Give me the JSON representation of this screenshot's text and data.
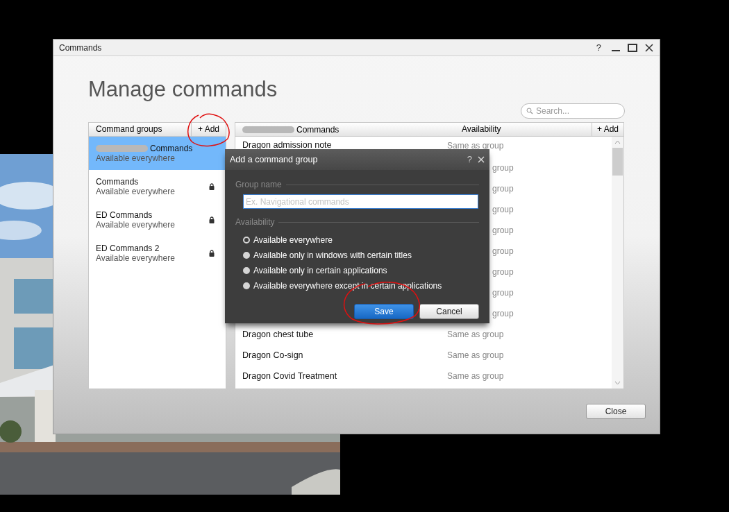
{
  "window": {
    "title": "Commands",
    "help": "?"
  },
  "heading": "Manage commands",
  "search": {
    "placeholder": "Search..."
  },
  "groups_panel": {
    "header": "Command groups",
    "add_button": "+ Add",
    "items": [
      {
        "name": "Commands",
        "subtitle": "Available everywhere",
        "selected": true,
        "locked": false,
        "redacted": true
      },
      {
        "name": "Commands",
        "subtitle": "Available everywhere",
        "selected": false,
        "locked": true,
        "redacted": false
      },
      {
        "name": "ED Commands",
        "subtitle": "Available everywhere",
        "selected": false,
        "locked": true,
        "redacted": false
      },
      {
        "name": "ED Commands 2",
        "subtitle": "Available everywhere",
        "selected": false,
        "locked": true,
        "redacted": false
      }
    ]
  },
  "commands_panel": {
    "header_redacted": true,
    "columns": [
      "Commands",
      "Availability"
    ],
    "add_button": "+ Add",
    "rows": [
      {
        "name": "Dragon admission note",
        "availability": "Same as group"
      },
      {
        "availability_fragment": "group"
      },
      {
        "availability_fragment": "group"
      },
      {
        "availability_fragment": "group"
      },
      {
        "availability_fragment": "group"
      },
      {
        "availability_fragment": "group"
      },
      {
        "availability_fragment": "group"
      },
      {
        "availability_fragment": "group"
      },
      {
        "availability_fragment": "group"
      },
      {
        "name": "Dragon chest tube",
        "availability": "Same as group"
      },
      {
        "name": "Dragon Co-sign",
        "availability": "Same as group"
      },
      {
        "name": "Dragon Covid Treatment",
        "availability": "Same as group"
      }
    ]
  },
  "close_button": "Close",
  "dialog": {
    "title": "Add a command group",
    "help": "?",
    "group_name": {
      "label": "Group name",
      "placeholder": "Ex. Navigational commands"
    },
    "availability": {
      "label": "Availability",
      "options": [
        {
          "label": "Available everywhere",
          "selected": true
        },
        {
          "label": "Available only in windows with certain titles",
          "selected": false
        },
        {
          "label": "Available only in certain applications",
          "selected": false
        },
        {
          "label": "Available everywhere except in certain applications",
          "selected": false
        }
      ]
    },
    "buttons": [
      {
        "label": "Save",
        "kind": "primary"
      },
      {
        "label": "Cancel",
        "kind": "secondary"
      }
    ]
  }
}
